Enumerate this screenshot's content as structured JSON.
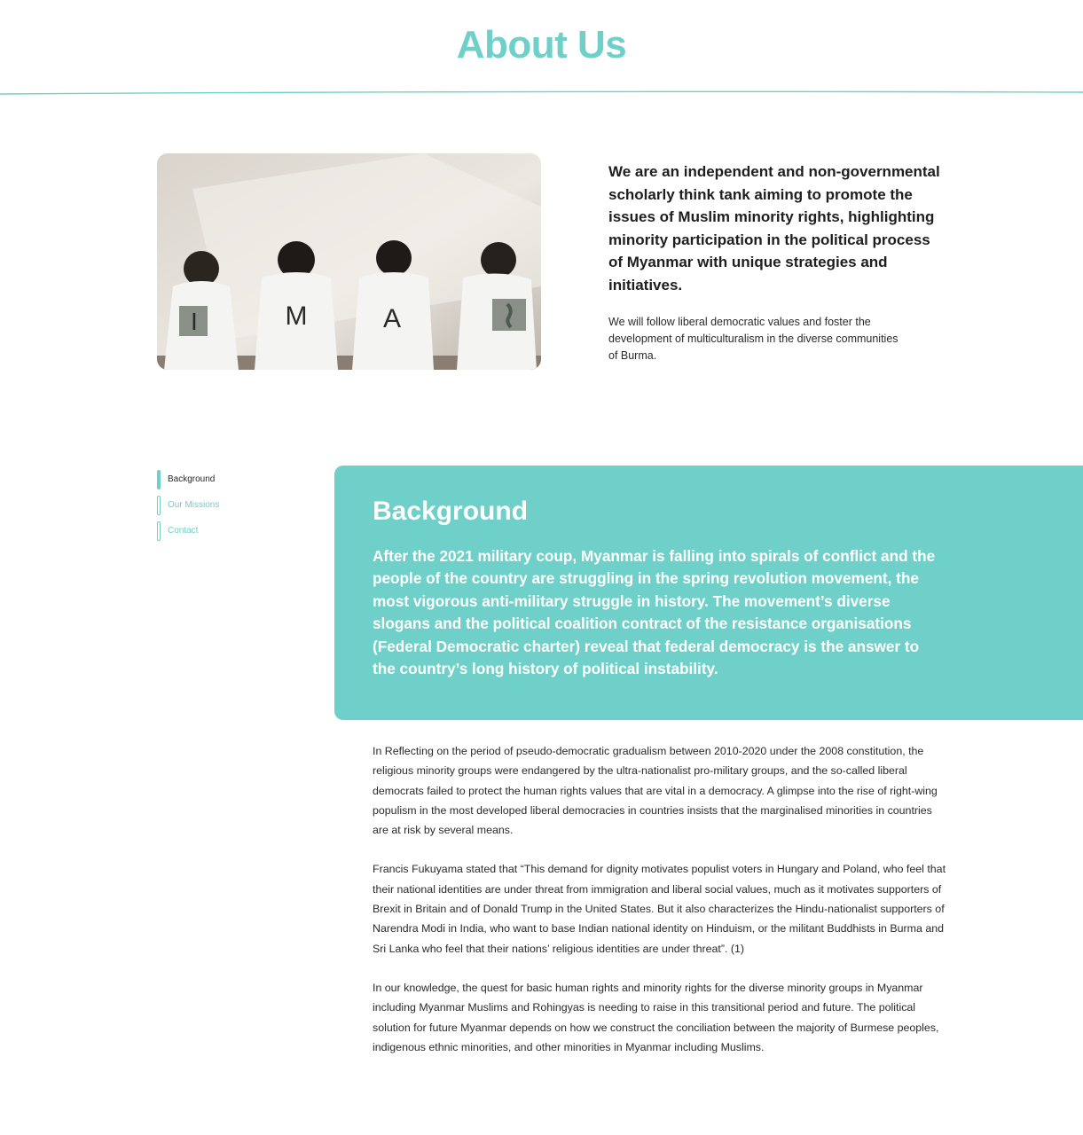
{
  "page": {
    "title": "About Us"
  },
  "hero": {
    "image_alt": "Four people in white t-shirts sitting facing a wall",
    "shirt_letters": [
      "I",
      "M",
      "A"
    ]
  },
  "intro": {
    "heading": "We are an independent and non-governmental scholarly think tank aiming to promote the issues of Muslim minority rights, highlighting minority participation in the political process of Myanmar with unique strategies and initiatives.",
    "subtext": "We will follow liberal democratic values and foster the development of multiculturalism in the diverse communities of Burma."
  },
  "sidebar": {
    "items": [
      {
        "label": "Background",
        "active": true
      },
      {
        "label": "Our Missions",
        "active": false
      },
      {
        "label": "Contact",
        "active": false
      }
    ]
  },
  "background": {
    "title": "Background",
    "lead": "After the 2021 military coup, Myanmar is falling into spirals of conflict and the people of the country are struggling in the spring revolution movement, the most vigorous anti-military struggle in history. The movement’s diverse slogans and the political coalition contract of the resistance organisations (Federal Democratic charter) reveal that federal democracy is the answer to the country’s long history of political instability.",
    "paragraphs": [
      "In Reflecting on the period of pseudo-democratic gradualism between 2010-2020 under the 2008 constitution, the religious minority groups were endangered by the ultra-nationalist pro-military groups, and the so-called liberal democrats failed to protect the human rights values that are vital in a democracy. A glimpse into the rise of right-wing populism in the most developed liberal democracies in countries insists that the marginalised minorities in countries are at risk by several means.",
      "Francis Fukuyama stated that “This demand for dignity motivates populist voters in Hungary and Poland, who feel that their national identities are under threat from immigration and liberal social values, much as it motivates supporters of Brexit in Britain and of Donald Trump in the United States. But it also characterizes the Hindu-nationalist supporters of Narendra Modi in India, who want to base Indian national identity on Hinduism, or the militant Buddhists in Burma and Sri Lanka who feel that their nations’ religious identities are under threat”. (1)",
      "In our knowledge, the quest for basic human rights and minority rights for the diverse minority groups in Myanmar including Myanmar Muslims and Rohingyas is needing to raise in this transitional period and future. The political solution for future Myanmar depends on how we construct the conciliation between the majority of Burmese peoples, indigenous ethnic minorities, and other minorities in Myanmar including Muslims."
    ]
  },
  "colors": {
    "accent": "#6fd0c9",
    "text": "#1e1e1e",
    "panel_text": "#ffffff"
  }
}
